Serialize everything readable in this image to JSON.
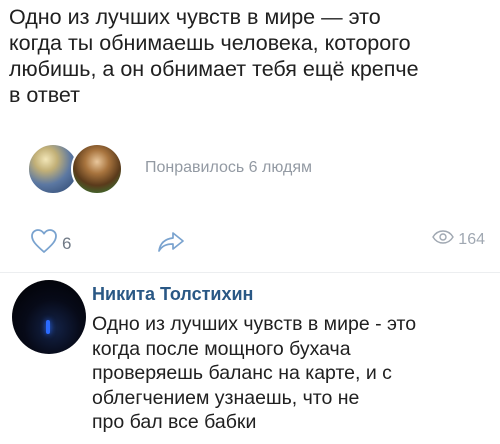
{
  "post": {
    "text_lines": [
      "Одно из лучших чувств в мире — это",
      "когда ты обнимаешь человека, которого",
      "любишь, а он обнимает тебя ещё крепче",
      "в ответ"
    ]
  },
  "likes": {
    "text": "Понравилось 6 людям",
    "avatars": [
      "liker-avatar-1",
      "liker-avatar-2"
    ]
  },
  "actions": {
    "like_count": "6",
    "views_count": "164",
    "icons": {
      "like": "heart-icon",
      "share": "share-arrow-icon",
      "views": "eye-icon"
    },
    "colors": {
      "icon": "#7aa3cf",
      "muted": "#a0a8b2"
    }
  },
  "comment": {
    "author": "Никита Толстихин",
    "text_lines": [
      "Одно из лучших чувств в мире - это",
      "когда после мощного бухача",
      "проверяешь баланс на карте, и с",
      "облегчением узнаешь, что не",
      "про бал все бабки"
    ],
    "colors": {
      "author": "#2a5885"
    }
  }
}
